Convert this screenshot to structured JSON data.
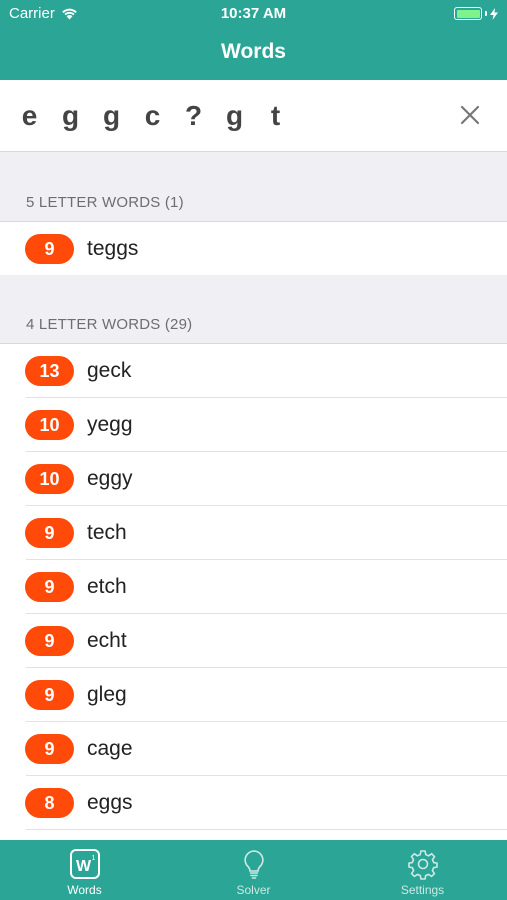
{
  "status": {
    "carrier": "Carrier",
    "time": "10:37 AM"
  },
  "nav": {
    "title": "Words"
  },
  "search": {
    "letters": [
      "e",
      "g",
      "g",
      "c",
      "?",
      "g",
      "t"
    ]
  },
  "sections": [
    {
      "title": "5 LETTER WORDS (1)",
      "rows": [
        {
          "score": "9",
          "word": "teggs"
        }
      ]
    },
    {
      "title": "4 LETTER WORDS (29)",
      "rows": [
        {
          "score": "13",
          "word": "geck"
        },
        {
          "score": "10",
          "word": "yegg"
        },
        {
          "score": "10",
          "word": "eggy"
        },
        {
          "score": "9",
          "word": "tech"
        },
        {
          "score": "9",
          "word": "etch"
        },
        {
          "score": "9",
          "word": "echt"
        },
        {
          "score": "9",
          "word": "gleg"
        },
        {
          "score": "9",
          "word": "cage"
        },
        {
          "score": "8",
          "word": "eggs"
        }
      ]
    }
  ],
  "tabs": [
    {
      "label": "Words",
      "icon": "words-icon",
      "active": true
    },
    {
      "label": "Solver",
      "icon": "lightbulb-icon",
      "active": false
    },
    {
      "label": "Settings",
      "icon": "gear-icon",
      "active": false
    }
  ],
  "colors": {
    "brand": "#2aa596",
    "badge": "#ff4a0a"
  }
}
